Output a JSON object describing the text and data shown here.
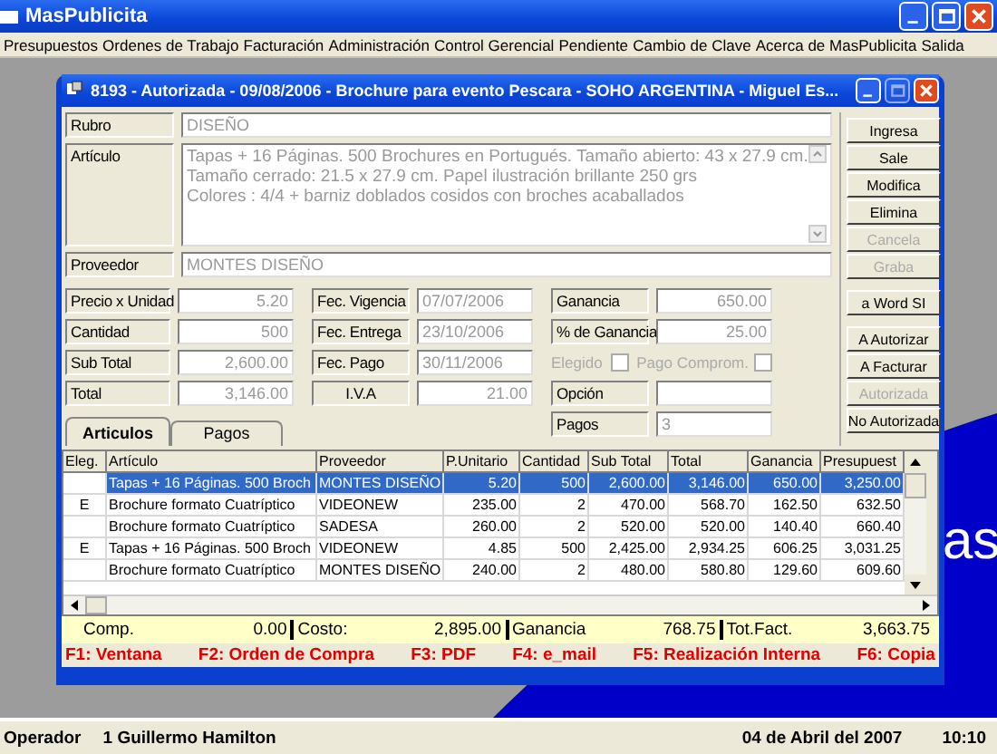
{
  "app": {
    "title": "MasPublicita"
  },
  "menu": [
    {
      "label": "Presupuestos"
    },
    {
      "label": "Ordenes de Trabajo"
    },
    {
      "label": "Facturación"
    },
    {
      "label": "Administración"
    },
    {
      "label": "Control Gerencial"
    },
    {
      "label": "Pendiente"
    },
    {
      "label": "Cambio de Clave"
    },
    {
      "label": "Acerca de MasPublicita"
    },
    {
      "label": "Salida"
    }
  ],
  "desktop": {
    "logo_fragment": "as"
  },
  "window": {
    "title": "8193 - Autorizada  - 09/08/2006 - Brochure para evento Pescara - SOHO ARGENTINA - Miguel Es...",
    "rubro": {
      "label": "Rubro",
      "value": "DISEÑO"
    },
    "articulo": {
      "label": "Artículo",
      "lines": [
        "Tapas + 16 Páginas. 500 Brochures en Portugués. Tamaño abierto: 43 x 27.9 cm.",
        "Tamaño cerrado: 21.5 x 27.9 cm. Papel ilustración brillante 250 grs",
        "Colores : 4/4 + barniz doblados cosidos con broches acaballados"
      ]
    },
    "proveedor": {
      "label": "Proveedor",
      "value": "MONTES DISEÑO"
    },
    "grid": [
      [
        {
          "kind": "number",
          "label": "Precio x Unidad",
          "value": "5.20"
        },
        {
          "kind": "date",
          "label": "Fec. Vigencia",
          "value": "07/07/2006"
        },
        {
          "kind": "number",
          "label": "Ganancia",
          "value": "650.00"
        }
      ],
      [
        {
          "kind": "number",
          "label": "Cantidad",
          "value": "500"
        },
        {
          "kind": "date",
          "label": "Fec. Entrega",
          "value": "23/10/2006"
        },
        {
          "kind": "number",
          "label": "% de Ganancia",
          "value": "25.00"
        }
      ],
      [
        {
          "kind": "number",
          "label": "Sub Total",
          "value": "2,600.00"
        },
        {
          "kind": "date",
          "label": "Fec. Pago",
          "value": "30/11/2006"
        },
        {
          "kind": "checks",
          "items": [
            {
              "label": "Elegido",
              "checked": false,
              "disabled": true
            },
            {
              "label": "Pago Comprom.",
              "checked": false,
              "disabled": true
            }
          ]
        }
      ],
      [
        {
          "kind": "number",
          "label": "Total",
          "value": "3,146.00"
        },
        {
          "kind": "number",
          "label": "I.V.A",
          "value": "21.00"
        },
        {
          "kind": "date",
          "label": "Opción"
        }
      ]
    ],
    "pagos": {
      "label": "Pagos",
      "value": "3"
    },
    "tabs": [
      {
        "label": "Articulos",
        "selected": true
      },
      {
        "label": "Pagos",
        "selected": false
      }
    ],
    "button_groups": [
      [
        {
          "label": "Ingresa",
          "disabled": false
        },
        {
          "label": "Sale",
          "disabled": false
        },
        {
          "label": "Modifica",
          "disabled": false
        },
        {
          "label": "Elimina",
          "disabled": false
        },
        {
          "label": "Cancela",
          "disabled": true
        },
        {
          "label": "Graba",
          "disabled": true
        }
      ],
      [
        {
          "label": "a Word SI",
          "disabled": false
        }
      ],
      [
        {
          "label": "A Autorizar",
          "disabled": false
        },
        {
          "label": "A Facturar",
          "disabled": false
        },
        {
          "label": "Autorizada",
          "disabled": true
        },
        {
          "label": "No Autorizada",
          "disabled": false
        }
      ]
    ],
    "table": {
      "columns": [
        "Eleg.",
        "Artículo",
        "Proveedor",
        "P.Unitario",
        "Cantidad",
        "Sub Total",
        "Total",
        "Ganancia",
        "Presupuest"
      ],
      "rows": [
        {
          "selected": true,
          "cells": [
            "",
            "Tapas + 16 Páginas. 500 Broch",
            "MONTES DISEÑO",
            "5.20",
            "500",
            "2,600.00",
            "3,146.00",
            "650.00",
            "3,250.00"
          ]
        },
        {
          "selected": false,
          "cells": [
            "E",
            "Brochure formato Cuatríptico",
            "VIDEONEW",
            "235.00",
            "2",
            "470.00",
            "568.70",
            "162.50",
            "632.50"
          ]
        },
        {
          "selected": false,
          "cells": [
            "",
            "Brochure formato Cuatríptico",
            "SADESA",
            "260.00",
            "2",
            "520.00",
            "520.00",
            "140.40",
            "660.40"
          ]
        },
        {
          "selected": false,
          "cells": [
            "E",
            "Tapas + 16 Páginas. 500 Broch",
            "VIDEONEW",
            "4.85",
            "500",
            "2,425.00",
            "2,934.25",
            "606.25",
            "3,031.25"
          ]
        },
        {
          "selected": false,
          "cells": [
            "",
            "Brochure formato Cuatríptico",
            "MONTES DISEÑO",
            "240.00",
            "2",
            "480.00",
            "580.80",
            "129.60",
            "609.60"
          ]
        }
      ]
    },
    "totals": [
      {
        "label": "Comp.",
        "value": "0.00"
      },
      {
        "label": "Costo:",
        "value": "2,895.00"
      },
      {
        "label": "Ganancia",
        "value": "768.75"
      },
      {
        "label": "Tot.Fact.",
        "value": "3,663.75"
      }
    ],
    "function_keys": [
      "F1: Ventana",
      "F2: Orden de Compra",
      "F3: PDF",
      "F4: e_mail",
      "F5: Realización Interna",
      "F6: Copia"
    ]
  },
  "status_bar": {
    "operator_label": "Operador",
    "operator": "1  Guillermo Hamilton",
    "date": "04 de Abril del 2007",
    "time": "10:10"
  }
}
